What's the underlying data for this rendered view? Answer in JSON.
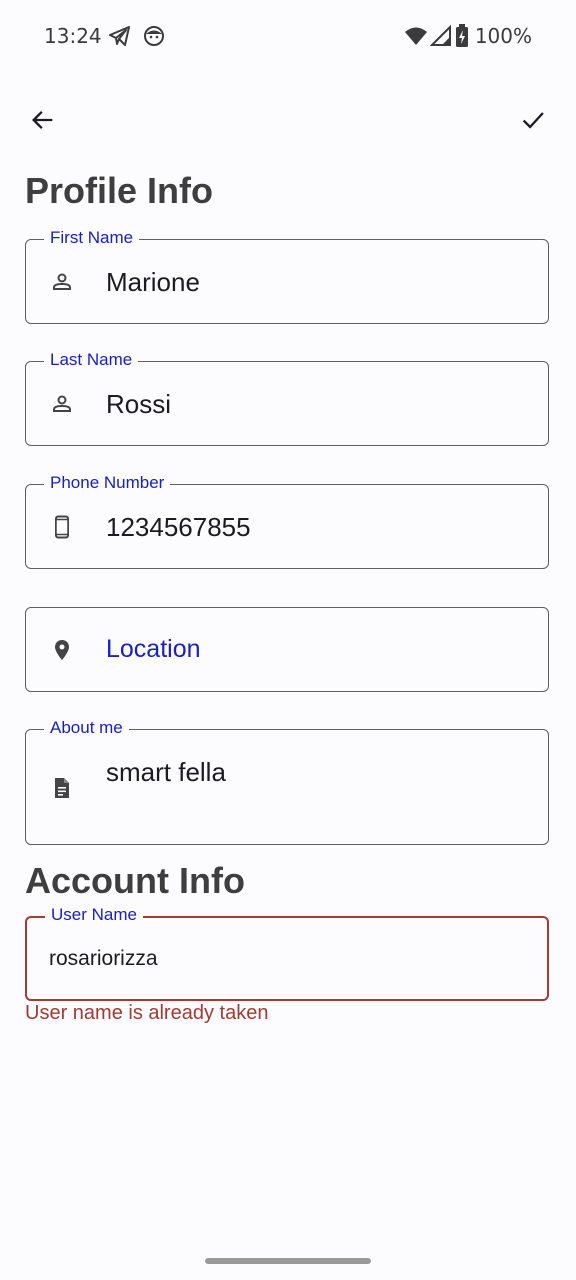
{
  "status_bar": {
    "time": "13:24",
    "battery": "100%",
    "icons": [
      "telegram-icon",
      "face-icon",
      "wifi-icon",
      "signal-icon",
      "battery-icon"
    ]
  },
  "toolbar": {
    "back_icon": "arrow-back-icon",
    "confirm_icon": "check-icon"
  },
  "profile": {
    "section_title": "Profile Info",
    "first_name": {
      "label": "First Name",
      "value": "Marione",
      "icon": "person-icon"
    },
    "last_name": {
      "label": "Last Name",
      "value": "Rossi",
      "icon": "person-icon"
    },
    "phone": {
      "label": "Phone Number",
      "value": "1234567855",
      "icon": "phone-icon"
    },
    "location": {
      "placeholder": "Location",
      "icon": "location-pin-icon"
    },
    "about": {
      "label": "About me",
      "value": "smart fella",
      "icon": "document-icon"
    }
  },
  "account": {
    "section_title": "Account Info",
    "username": {
      "label": "User Name",
      "value": "rosariorizza",
      "error": "User name is already taken"
    }
  },
  "colors": {
    "label": "#1a21c0",
    "error": "#a33a33",
    "border": "#5f5f5f",
    "background": "#fcfbfd"
  }
}
